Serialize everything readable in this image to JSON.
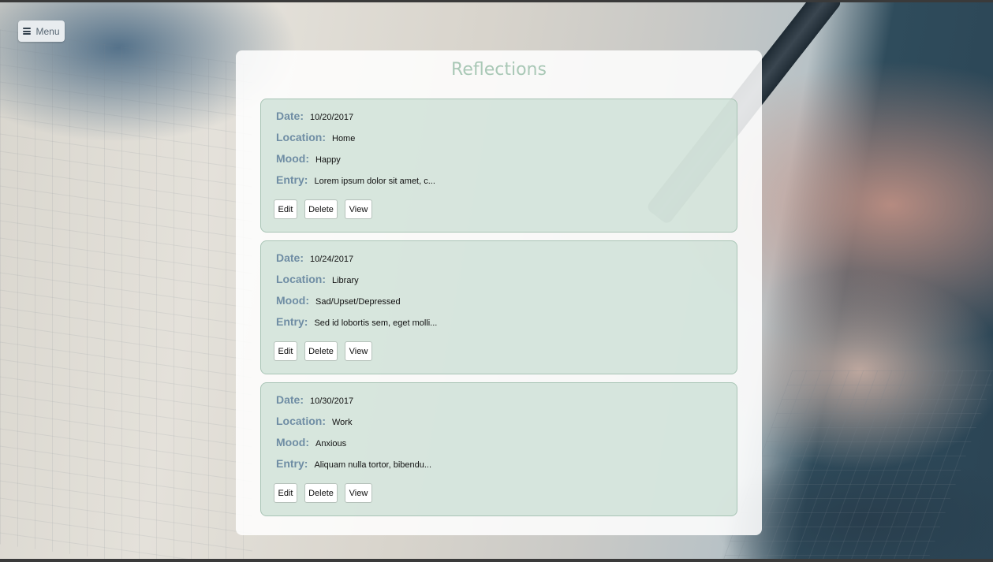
{
  "menu": {
    "label": "Menu",
    "icon": "hamburger-icon"
  },
  "page_title": "Reflections",
  "field_labels": {
    "date": "Date:",
    "location": "Location:",
    "mood": "Mood:",
    "entry": "Entry:"
  },
  "buttons": {
    "edit": "Edit",
    "delete": "Delete",
    "view": "View"
  },
  "entries": [
    {
      "date": "10/20/2017",
      "location": "Home",
      "mood": "Happy",
      "entry": "Lorem ipsum dolor sit amet, c..."
    },
    {
      "date": "10/24/2017",
      "location": "Library",
      "mood": "Sad/Upset/Depressed",
      "entry": "Sed id lobortis sem, eget molli..."
    },
    {
      "date": "10/30/2017",
      "location": "Work",
      "mood": "Anxious",
      "entry": "Aliquam nulla tortor, bibendu..."
    }
  ],
  "colors": {
    "title": "#a9c8b6",
    "label": "#6f8da4",
    "card_bg": "#c8ddd2",
    "card_border": "#a8c4b5"
  }
}
